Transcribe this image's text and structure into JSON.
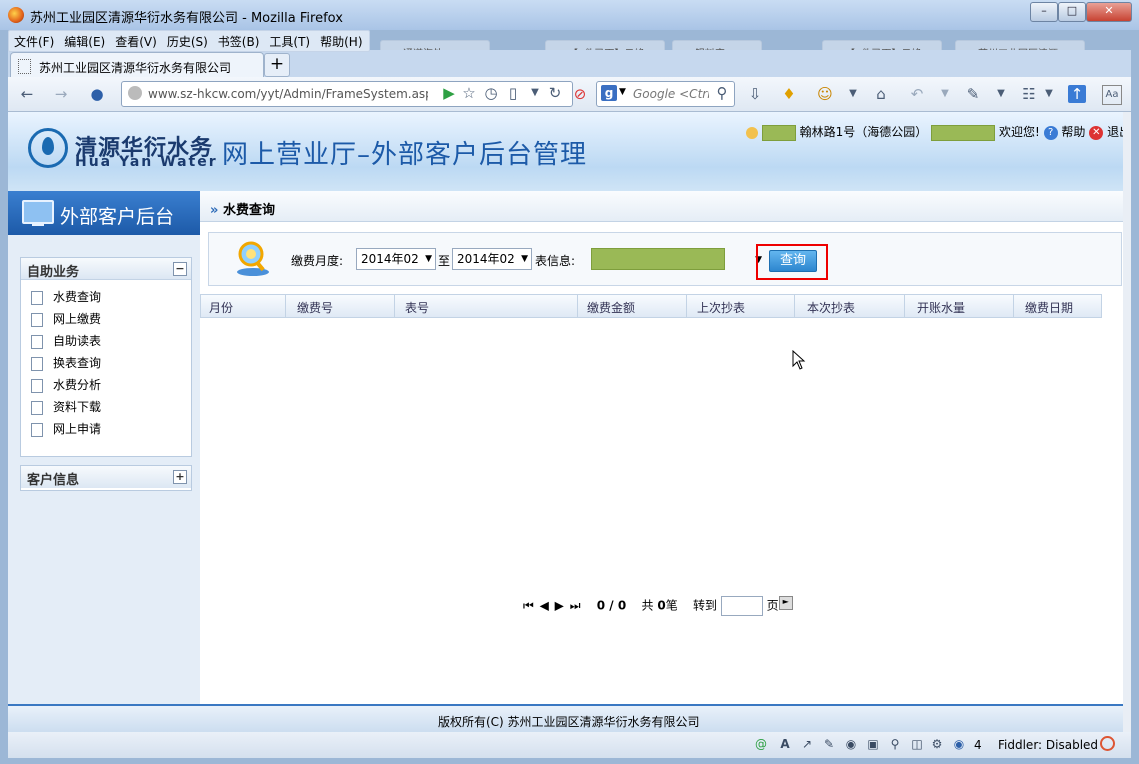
{
  "window": {
    "title": "苏州工业园区清源华衍水务有限公司 - Mozilla Firefox",
    "min": "–",
    "max": "□",
    "close": "✕"
  },
  "menu": [
    "文件(F)",
    "编辑(E)",
    "查看(V)",
    "历史(S)",
    "书签(B)",
    "工具(T)",
    "帮助(H)"
  ],
  "tabs": {
    "active_label": "苏州工业园区清源华衍水务有限公司",
    "new_tab": "+",
    "ghost": [
      "通道海外...",
      "【6件已下】云峰...",
      "铝料宗...",
      "【6件已下】云峰...",
      "苏州工业园区清源..."
    ]
  },
  "nav": {
    "url": "www.sz-hkcw.com/yyt/Admin/FrameSystem.aspx?url:",
    "search_placeholder": "Google <Ctrl+K>",
    "search_engine_icon": "g"
  },
  "header": {
    "logo_cn": "清源华衍水务",
    "logo_en": "Hua Yan Water",
    "title": "网上营业厅–外部客户后台管理",
    "address": "翰林路1号（海德公园）",
    "welcome": "欢迎您!",
    "help": "帮助",
    "exit": "退出"
  },
  "sidebar": {
    "title": "外部客户后台",
    "panels": [
      {
        "title": "自助业务",
        "toggle": "−",
        "items": [
          "水费查询",
          "网上缴费",
          "自助读表",
          "换表查询",
          "水费分析",
          "资料下载",
          "网上申请"
        ]
      },
      {
        "title": "客户信息",
        "toggle": "+"
      }
    ]
  },
  "content": {
    "title": "水费查询",
    "breadcrumb_icon": "»",
    "filter": {
      "month_label": "缴费月度:",
      "from": "2014年02",
      "to_label": "至",
      "to": "2014年02",
      "meter_label": "表信息:",
      "query_button": "查询"
    },
    "columns": [
      "月份",
      "缴费号",
      "表号",
      "缴费金额",
      "上次抄表",
      "本次抄表",
      "开账水量",
      "缴费日期"
    ],
    "pager": {
      "nav": "⏮ ◀ ▶ ⏭",
      "page": "0 / 0",
      "total_prefix": "共",
      "total": "0",
      "total_suffix": "笔",
      "goto": "转到",
      "page_suffix": "页"
    }
  },
  "footer": {
    "text": "版权所有(C)  苏州工业园区清源华衍水务有限公司"
  },
  "statusbar": {
    "count": "4",
    "fiddler": "Fiddler: Disabled"
  }
}
